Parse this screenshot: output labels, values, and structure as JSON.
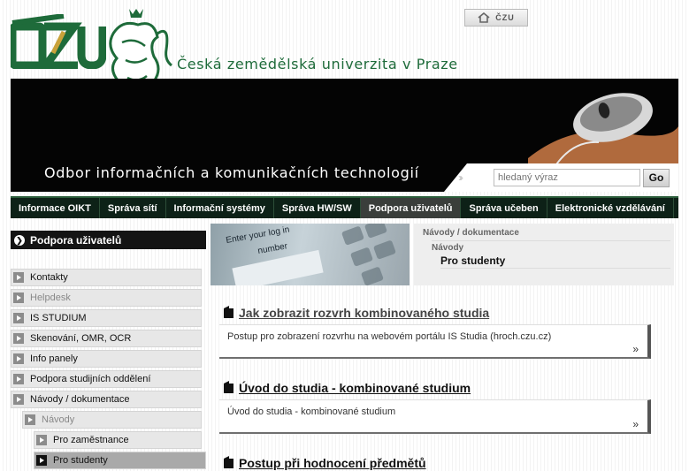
{
  "header": {
    "university_name": "Česká zemědělská univerzita v Praze",
    "home_label": "ČZU",
    "banner_title": "Odbor informačních a komunikačních technologií"
  },
  "search": {
    "placeholder": "hledaný výraz",
    "button": "Go"
  },
  "nav": {
    "items": [
      "Informace OIKT",
      "Správa sítí",
      "Informační systémy",
      "Správa HW/SW",
      "Podpora uživatelů",
      "Správa učeben",
      "Elektronické vzdělávání"
    ],
    "active": "Podpora uživatelů"
  },
  "sidebar": {
    "title": "Podpora uživatelů",
    "items": [
      "Kontakty",
      "Helpdesk",
      "IS STUDIUM",
      "Skenování, OMR, OCR",
      "Info panely",
      "Podpora studijních oddělení",
      "Návody / dokumentace"
    ],
    "sub_item": "Návody",
    "sub_sub_items": [
      "Pro zaměstnance",
      "Pro studenty"
    ],
    "active": "Pro studenty"
  },
  "banner_image_text": {
    "line1": "Enter your log in",
    "line2": "number"
  },
  "breadcrumb": {
    "level1": "Návody / dokumentace",
    "level2": "Návody",
    "level3": "Pro studenty"
  },
  "articles": [
    {
      "title": "Jak zobrazit rozvrh kombinovaného studia",
      "desc": "Postup pro zobrazení rozvrhu na webovém portálu IS Studia (hroch.czu.cz)",
      "more": "»"
    },
    {
      "title": "Úvod do studia - kombinované studium",
      "desc": "Úvod do studia - kombinované studium",
      "more": "»"
    },
    {
      "title": "Postup při hodnocení předmětů"
    }
  ],
  "colors": {
    "brand_green": "#1e6b3a",
    "nav_bg": "#0d2117",
    "banner_bg": "#040404"
  }
}
